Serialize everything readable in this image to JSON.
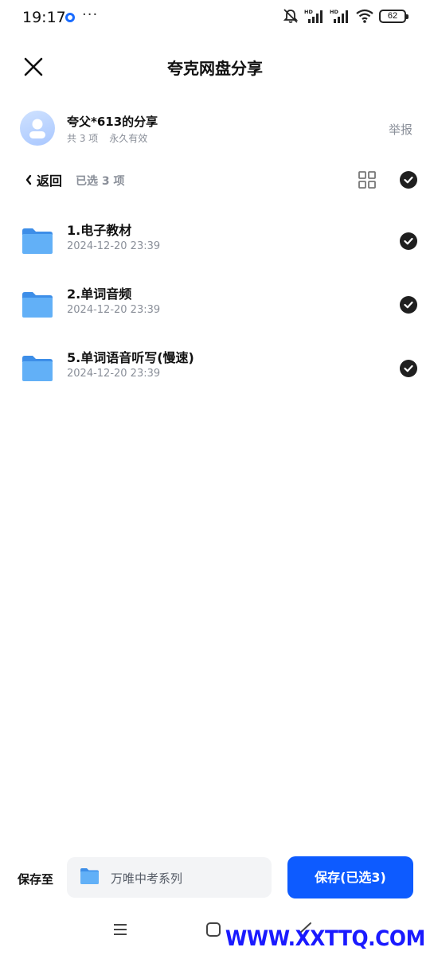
{
  "status_bar": {
    "time": "19:17",
    "more": "···",
    "battery": "62",
    "hd_labels": [
      "HD",
      "HD"
    ]
  },
  "header": {
    "title": "夸克网盘分享",
    "close_icon": "close-icon"
  },
  "sharer": {
    "name": "夸父*613的分享",
    "item_count": "共 3 项",
    "validity": "永久有效",
    "report": "举报"
  },
  "toolbar": {
    "back_label": "返回",
    "selected_count": "已选 3 项",
    "grid_icon": "grid-view-icon",
    "select_all_icon": "check-circle-icon"
  },
  "files": [
    {
      "name": "1.电子教材",
      "date": "2024-12-20 23:39",
      "selected": true
    },
    {
      "name": "2.单词音频",
      "date": "2024-12-20 23:39",
      "selected": true
    },
    {
      "name": "5.单词语音听写(慢速)",
      "date": "2024-12-20 23:39",
      "selected": true
    }
  ],
  "bottom_bar": {
    "save_to_label": "保存至",
    "destination": "万唯中考系列",
    "save_button": "保存(已选3)"
  },
  "colors": {
    "accent": "#0d5bff",
    "folder": "#5aaaf5",
    "muted_text": "#8a8f99"
  },
  "watermark": "WWW.XXTTQ.COM"
}
